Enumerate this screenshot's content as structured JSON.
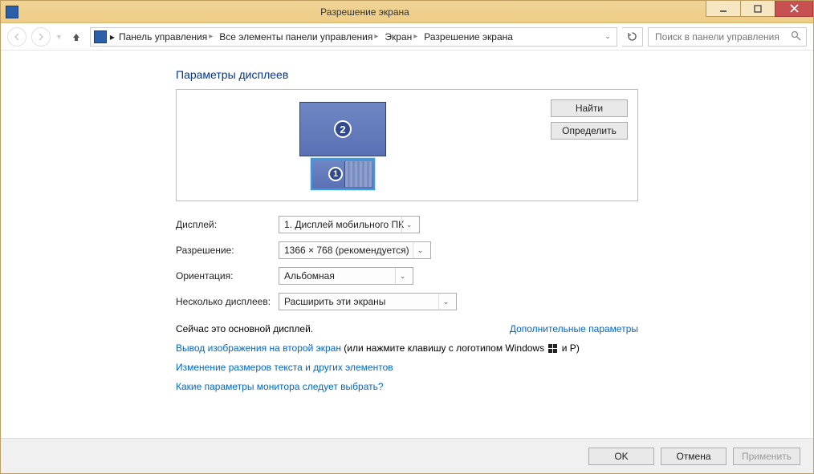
{
  "window": {
    "title": "Разрешение экрана"
  },
  "breadcrumb": {
    "items": [
      "Панель управления",
      "Все элементы панели управления",
      "Экран",
      "Разрешение экрана"
    ]
  },
  "search": {
    "placeholder": "Поиск в панели управления"
  },
  "page": {
    "heading": "Параметры дисплеев",
    "find": "Найти",
    "identify": "Определить",
    "monitors": {
      "primary_number": "1",
      "secondary_number": "2"
    }
  },
  "form": {
    "display_label": "Дисплей:",
    "display_value": "1. Дисплей мобильного ПК",
    "resolution_label": "Разрешение:",
    "resolution_value": "1366 × 768 (рекомендуется)",
    "orientation_label": "Ориентация:",
    "orientation_value": "Альбомная",
    "multi_label": "Несколько дисплеев:",
    "multi_value": "Расширить эти экраны"
  },
  "primary_note": "Сейчас это основной дисплей.",
  "advanced_link": "Дополнительные параметры",
  "links": {
    "project_prefix": "Вывод изображения на второй экран",
    "project_suffix_1": " (или нажмите клавишу с логотипом Windows ",
    "project_suffix_2": " и P)",
    "resize_text": "Изменение размеров текста и других элементов",
    "which_settings": "Какие параметры монитора следует выбрать?"
  },
  "footer": {
    "ok": "OK",
    "cancel": "Отмена",
    "apply": "Применить"
  }
}
